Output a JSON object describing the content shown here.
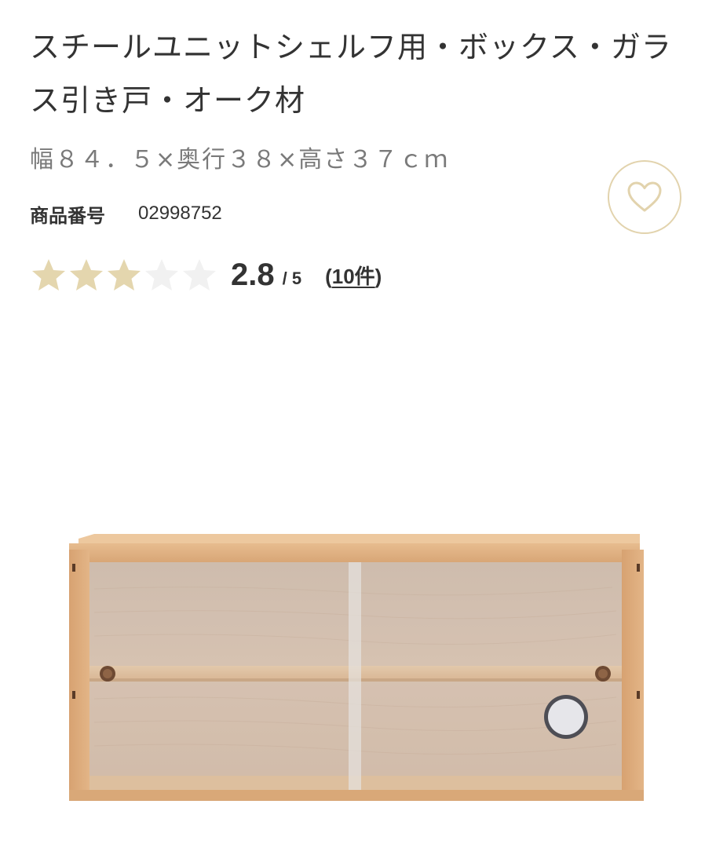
{
  "product": {
    "title": "スチールユニットシェルフ用・ボックス・ガラス引き戸・オーク材",
    "size": "幅８４．５×奥行３８×高さ３７ｃｍ",
    "code_label": "商品番号",
    "code_value": "02998752",
    "rating": {
      "value": "2.8",
      "max": "/ 5",
      "count_open": "(",
      "count": "10件",
      "count_close": ")",
      "filled_stars": 3,
      "total_stars": 5,
      "star_filled_color": "#e4d6ae",
      "star_empty_color": "#f1f1f1"
    },
    "favorite_icon": "heart-icon",
    "image_alt_icon": "glass-door-oak-box-image"
  },
  "colors": {
    "text": "#333333",
    "muted_text": "#7a7a7a",
    "accent_border": "#e2d3ad",
    "oak": "#d9a878"
  }
}
